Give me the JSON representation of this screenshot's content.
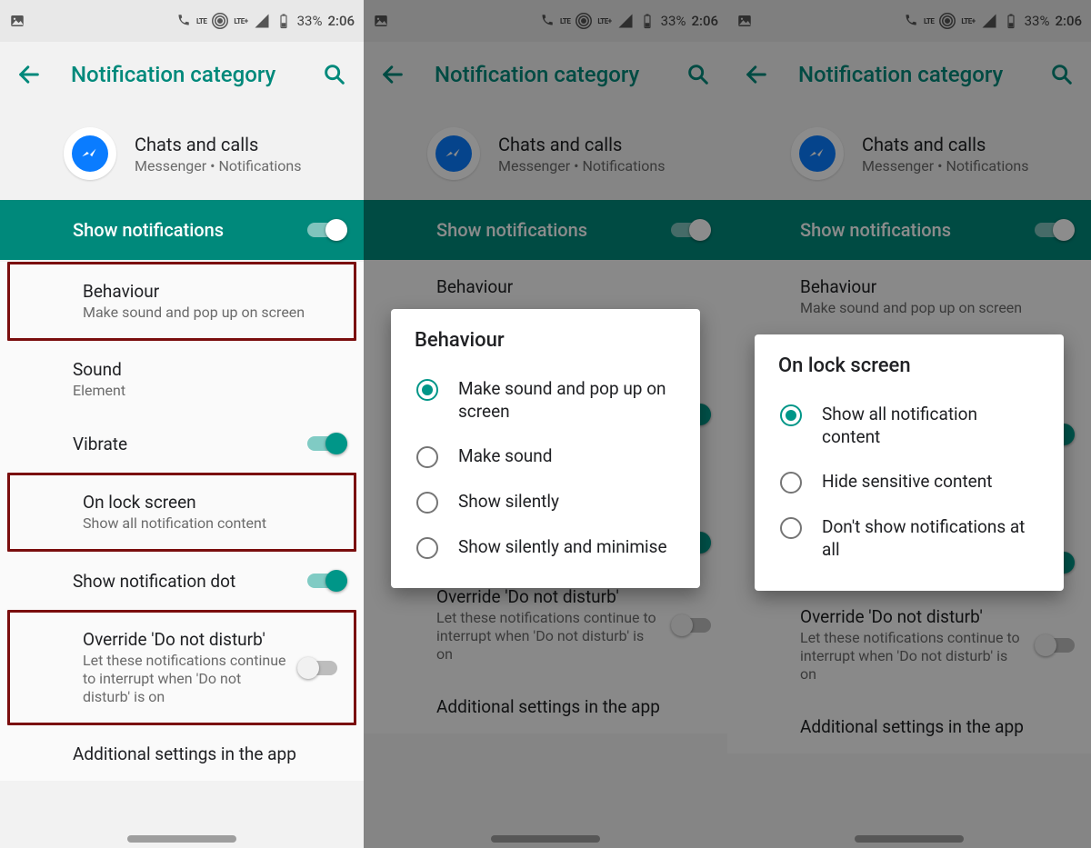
{
  "status": {
    "battery_pct": "33%",
    "time": "2:06",
    "lte_label": "LTE",
    "lte_plus_label": "LTE+"
  },
  "appbar": {
    "title": "Notification category"
  },
  "category": {
    "title": "Chats and calls",
    "subtitle": "Messenger • Notifications"
  },
  "show_notifications": {
    "label": "Show notifications",
    "on": true
  },
  "rows": {
    "behaviour": {
      "title": "Behaviour",
      "sub": "Make sound and pop up on screen"
    },
    "sound": {
      "title": "Sound",
      "sub": "Element"
    },
    "vibrate": {
      "title": "Vibrate",
      "on": true
    },
    "lockscreen": {
      "title": "On lock screen",
      "sub": "Show all notification content"
    },
    "dot": {
      "title": "Show notification dot",
      "on": true
    },
    "dnd": {
      "title": "Override 'Do not disturb'",
      "sub": "Let these notifications continue to interrupt when 'Do not disturb' is on",
      "on": false
    },
    "additional": {
      "title": "Additional settings in the app"
    }
  },
  "dialogs": {
    "behaviour": {
      "title": "Behaviour",
      "options": [
        "Make sound and pop up on screen",
        "Make sound",
        "Show silently",
        "Show silently and minimise"
      ],
      "selected": 0
    },
    "lockscreen": {
      "title": "On lock screen",
      "options": [
        "Show all notification content",
        "Hide sensitive content",
        "Don't show notifications at all"
      ],
      "selected": 0
    }
  }
}
